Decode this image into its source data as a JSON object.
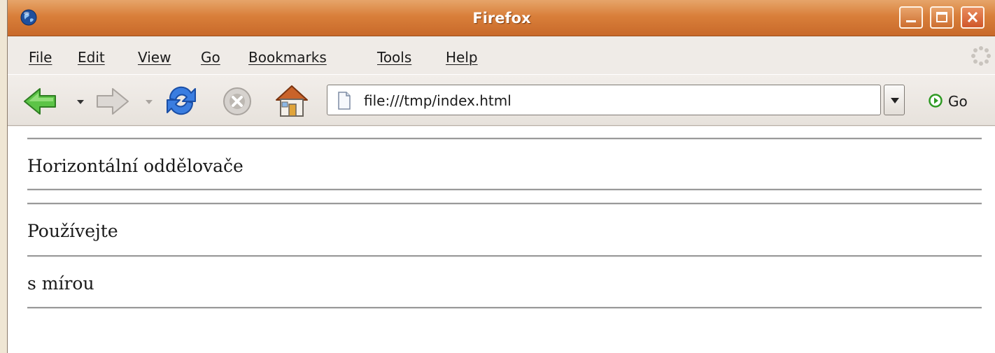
{
  "window": {
    "title": "Firefox"
  },
  "menu": {
    "items": [
      "File",
      "Edit",
      "View",
      "Go",
      "Bookmarks",
      "Tools",
      "Help"
    ]
  },
  "navbar": {
    "url": "file:///tmp/index.html",
    "go_label": "Go"
  },
  "content": {
    "lines": [
      "Horizontální oddělovače",
      "Používejte",
      "s mírou"
    ]
  },
  "icons": {
    "app": "globe-icon",
    "back": "back-arrow-icon",
    "forward": "forward-arrow-icon",
    "reload": "reload-icon",
    "stop": "stop-icon",
    "home": "home-icon",
    "page": "page-icon",
    "go": "go-icon",
    "throbber": "throbber-icon"
  },
  "colors": {
    "titlebar": "#d97f3a",
    "back_arrow": "#4fb43a",
    "reload": "#2f6fd6"
  }
}
